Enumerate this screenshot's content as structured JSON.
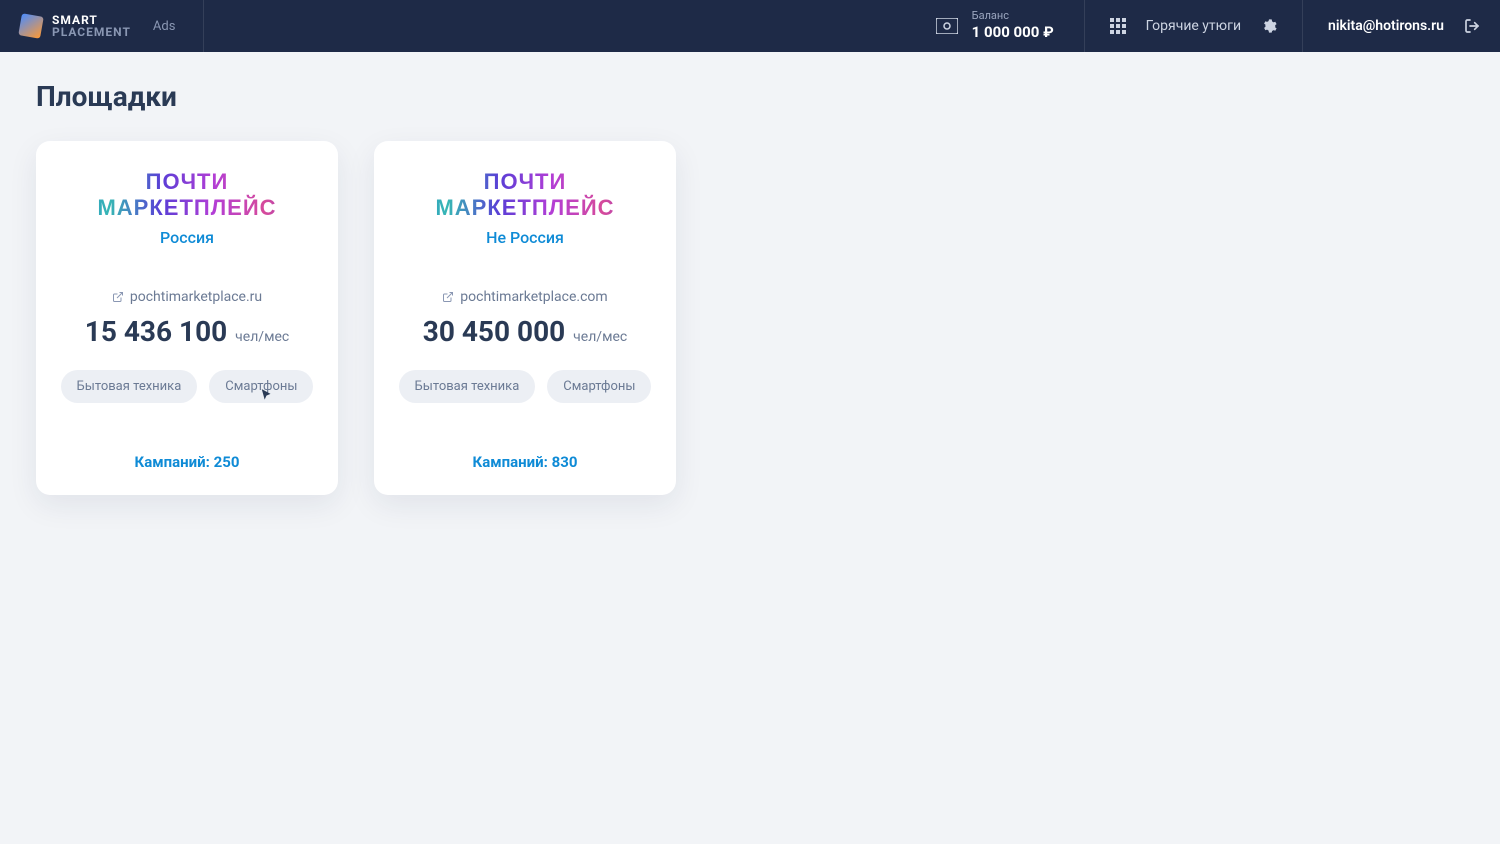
{
  "header": {
    "logo": {
      "line1": "SMART",
      "line2": "PLACEMENT",
      "suffix": "Ads"
    },
    "balance": {
      "label": "Баланс",
      "value": "1 000 000 ₽"
    },
    "hot_irons_label": "Горячие утюги",
    "user_email": "nikita@hotirons.ru"
  },
  "page": {
    "title": "Площадки"
  },
  "cards": [
    {
      "brand_line1": "ПОЧТИ",
      "brand_line2": "МАРКЕТПЛЕЙС",
      "region": "Россия",
      "domain": "pochtimarketplace.ru",
      "metric_value": "15 436 100",
      "metric_unit": "чел/мес",
      "tags": [
        "Бытовая техника",
        "Смартфоны"
      ],
      "campaigns_label": "Кампаний: 250"
    },
    {
      "brand_line1": "ПОЧТИ",
      "brand_line2": "МАРКЕТПЛЕЙС",
      "region": "Не Россия",
      "domain": "pochtimarketplace.com",
      "metric_value": "30 450 000",
      "metric_unit": "чел/мес",
      "tags": [
        "Бытовая техника",
        "Смартфоны"
      ],
      "campaigns_label": "Кампаний: 830"
    }
  ]
}
